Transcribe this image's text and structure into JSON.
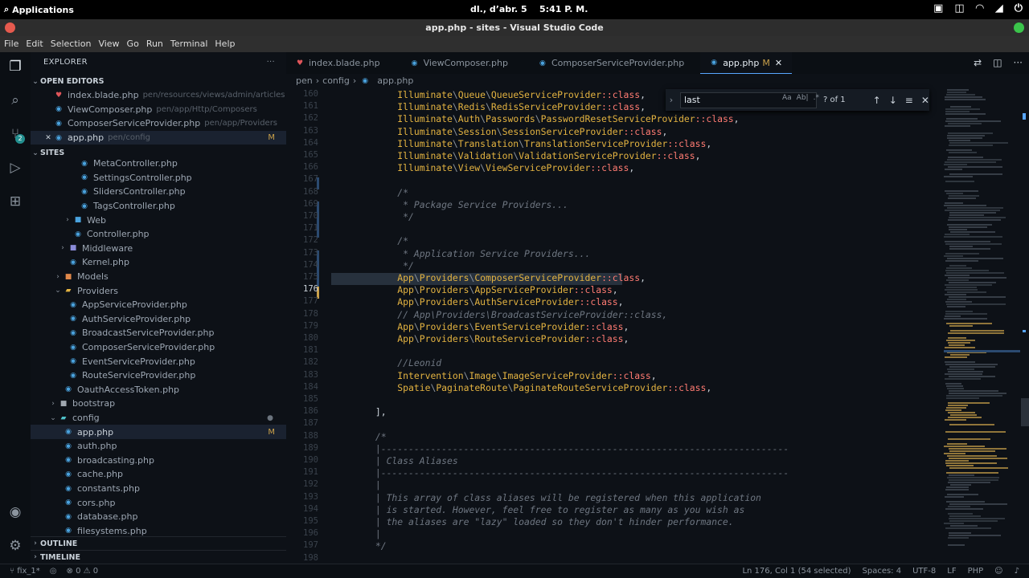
{
  "system_bar": {
    "apps_label": "Applications",
    "clock_day": "dl., d’abr.  5",
    "clock_time": "5:41 P. M."
  },
  "window": {
    "title": "app.php - sites - Visual Studio Code"
  },
  "menu": [
    "File",
    "Edit",
    "Selection",
    "View",
    "Go",
    "Run",
    "Terminal",
    "Help"
  ],
  "activity": {
    "scm_badge": "2"
  },
  "explorer": {
    "header": "EXPLORER",
    "more": "···",
    "open_editors_label": "OPEN EDITORS",
    "open_editors": [
      {
        "name": "index.blade.php",
        "path": "pen/resources/views/admin/articles",
        "icon": "blade-file-icon",
        "status": ""
      },
      {
        "name": "ViewComposer.php",
        "path": "pen/app/Http/Composers",
        "icon": "php-file-icon",
        "status": ""
      },
      {
        "name": "ComposerServiceProvider.php",
        "path": "pen/app/Providers",
        "icon": "php-file-icon",
        "status": ""
      },
      {
        "name": "app.php",
        "path": "pen/config",
        "icon": "php-file-icon",
        "status": "M"
      }
    ],
    "workspace_label": "SITES",
    "tree": [
      {
        "name": "MetaController.php",
        "kind": "php"
      },
      {
        "name": "SettingsController.php",
        "kind": "php"
      },
      {
        "name": "SlidersController.php",
        "kind": "php"
      },
      {
        "name": "TagsController.php",
        "kind": "php"
      },
      {
        "name": "Web",
        "kind": "folder-blue"
      },
      {
        "name": "Controller.php",
        "kind": "php"
      },
      {
        "name": "Middleware",
        "kind": "folder-purple"
      },
      {
        "name": "Kernel.php",
        "kind": "php"
      },
      {
        "name": "Models",
        "kind": "folder-orange"
      },
      {
        "name": "Providers",
        "kind": "folder-yellow"
      },
      {
        "name": "AppServiceProvider.php",
        "kind": "php"
      },
      {
        "name": "AuthServiceProvider.php",
        "kind": "php"
      },
      {
        "name": "BroadcastServiceProvider.php",
        "kind": "php"
      },
      {
        "name": "ComposerServiceProvider.php",
        "kind": "php"
      },
      {
        "name": "EventServiceProvider.php",
        "kind": "php"
      },
      {
        "name": "RouteServiceProvider.php",
        "kind": "php"
      },
      {
        "name": "OauthAccessToken.php",
        "kind": "php"
      },
      {
        "name": "bootstrap",
        "kind": "folder"
      },
      {
        "name": "config",
        "kind": "folder-teal"
      },
      {
        "name": "app.php",
        "kind": "php",
        "status": "M"
      },
      {
        "name": "auth.php",
        "kind": "php"
      },
      {
        "name": "broadcasting.php",
        "kind": "php"
      },
      {
        "name": "cache.php",
        "kind": "php"
      },
      {
        "name": "constants.php",
        "kind": "php"
      },
      {
        "name": "cors.php",
        "kind": "php"
      },
      {
        "name": "database.php",
        "kind": "php"
      },
      {
        "name": "filesystems.php",
        "kind": "php"
      }
    ],
    "config_dot": "●",
    "outline_label": "OUTLINE",
    "timeline_label": "TIMELINE"
  },
  "tabs": [
    {
      "label": "index.blade.php",
      "icon": "blade-file-icon"
    },
    {
      "label": "ViewComposer.php",
      "icon": "php-file-icon"
    },
    {
      "label": "ComposerServiceProvider.php",
      "icon": "php-file-icon"
    },
    {
      "label": "app.php",
      "icon": "php-file-icon",
      "mark": "M",
      "active": true
    }
  ],
  "breadcrumb": [
    "pen",
    "config",
    "app.php"
  ],
  "find": {
    "query": "last",
    "opt_case": "Aa",
    "opt_word": "Ab|",
    "opt_regex": ".*",
    "count": "? of 1"
  },
  "code": {
    "first_line": 160,
    "current_line": 176,
    "lines": [
      "            Illuminate\\Queue\\QueueServiceProvider::class,",
      "            Illuminate\\Redis\\RedisServiceProvider::class,",
      "            Illuminate\\Auth\\Passwords\\PasswordResetServiceProvider::class,",
      "            Illuminate\\Session\\SessionServiceProvider::class,",
      "            Illuminate\\Translation\\TranslationServiceProvider::class,",
      "            Illuminate\\Validation\\ValidationServiceProvider::class,",
      "            Illuminate\\View\\ViewServiceProvider::class,",
      "",
      "            /*",
      "             * Package Service Providers...",
      "             */",
      "",
      "            /*",
      "             * Application Service Providers...",
      "             */",
      "            App\\Providers\\ComposerServiceProvider::class,",
      "            App\\Providers\\AppServiceProvider::class,",
      "            App\\Providers\\AuthServiceProvider::class,",
      "            // App\\Providers\\BroadcastServiceProvider::class,",
      "            App\\Providers\\EventServiceProvider::class,",
      "            App\\Providers\\RouteServiceProvider::class,",
      "",
      "            //Leonid",
      "            Intervention\\Image\\ImageServiceProvider::class,",
      "            Spatie\\PaginateRoute\\PaginateRouteServiceProvider::class,",
      "",
      "        ],",
      "",
      "        /*",
      "        |--------------------------------------------------------------------------",
      "        | Class Aliases",
      "        |--------------------------------------------------------------------------",
      "        |",
      "        | This array of class aliases will be registered when this application",
      "        | is started. However, feel free to register as many as you wish as",
      "        | the aliases are \"lazy\" loaded so they don't hinder performance.",
      "        |",
      "        */",
      ""
    ]
  },
  "status": {
    "branch": "fix_1*",
    "problems": "⊗ 0 ⚠ 0",
    "position": "Ln 176, Col 1 (54 selected)",
    "spaces": "Spaces: 4",
    "encoding": "UTF-8",
    "eol": "LF",
    "language": "PHP"
  }
}
